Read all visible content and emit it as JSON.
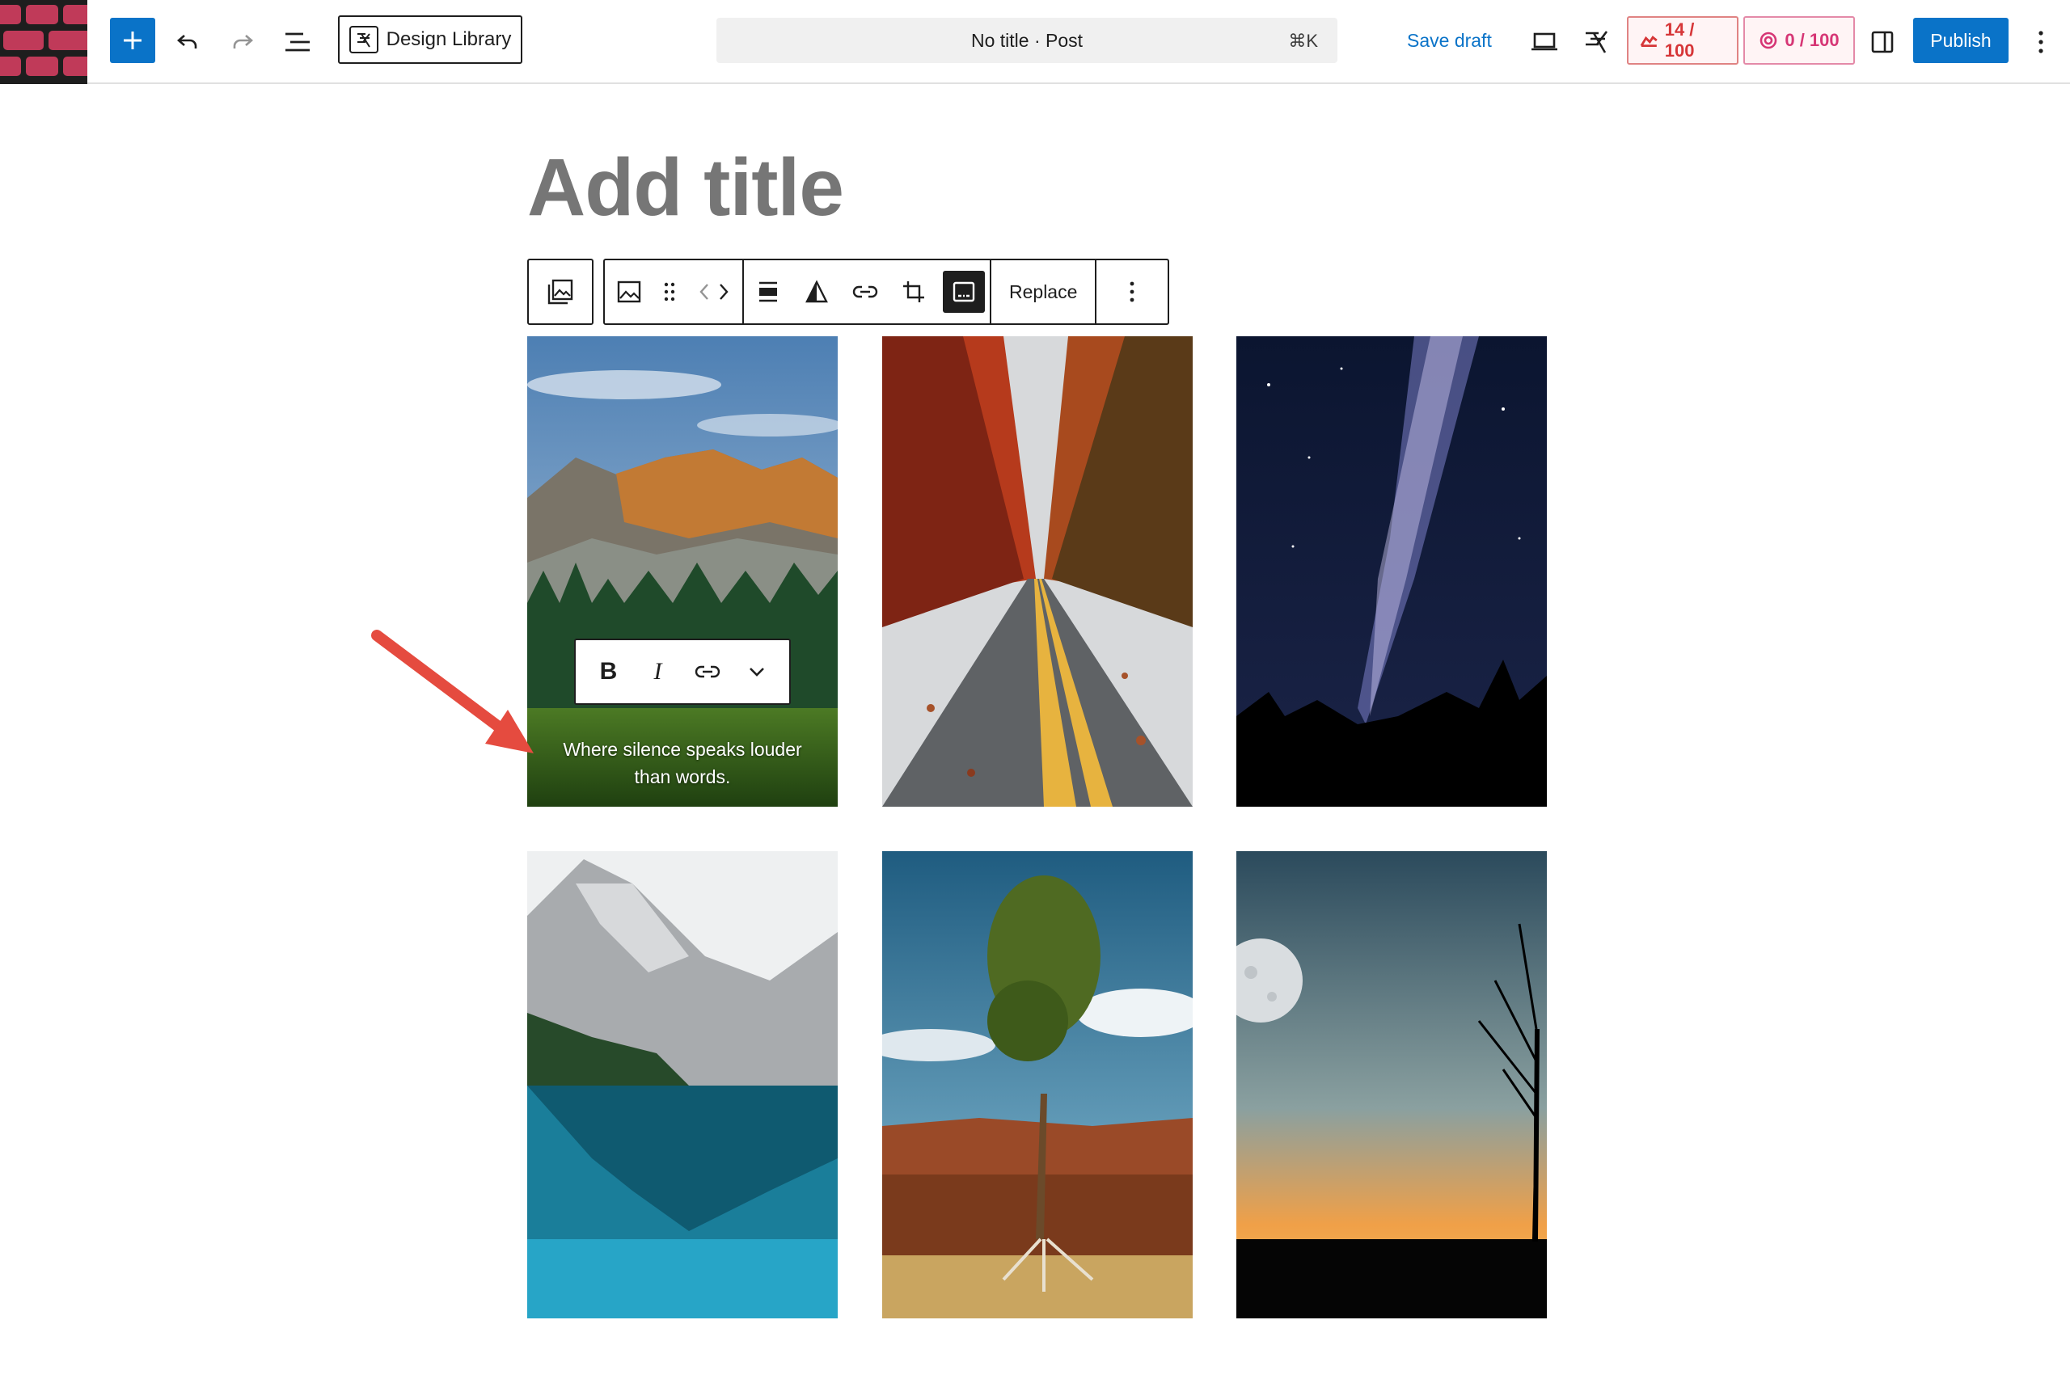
{
  "header": {
    "design_library_label": "Design Library",
    "command_center": {
      "label": "No title · Post",
      "shortcut": "⌘K"
    },
    "save_draft_label": "Save draft",
    "score_a": "14 / 100",
    "score_b": "0 / 100",
    "publish_label": "Publish",
    "accent_color": "#0a73c8"
  },
  "editor": {
    "title_placeholder": "Add title",
    "block_toolbar": {
      "replace_label": "Replace"
    },
    "format_toolbar": {
      "bold": "B",
      "italic": "I"
    }
  },
  "gallery": {
    "images": [
      {
        "subject": "mountain-forest",
        "caption": "Where silence speaks louder than words."
      },
      {
        "subject": "autumn-road"
      },
      {
        "subject": "milky-way-night"
      },
      {
        "subject": "alpine-lake"
      },
      {
        "subject": "lone-tree-canyon"
      },
      {
        "subject": "moon-sunset-tree"
      }
    ]
  },
  "icons": [
    "site-logo-icon",
    "plus-icon",
    "undo-icon",
    "redo-icon",
    "list-view-icon",
    "design-library-icon",
    "preview-icon",
    "performance-icon",
    "seo-score-icon",
    "readability-score-icon",
    "sidebar-toggle-icon",
    "more-vertical-icon",
    "gallery-icon",
    "image-icon",
    "drag-handle-icon",
    "move-icon",
    "align-icon",
    "contrast-icon",
    "link-icon",
    "crop-icon",
    "caption-icon",
    "chevron-down-icon"
  ]
}
